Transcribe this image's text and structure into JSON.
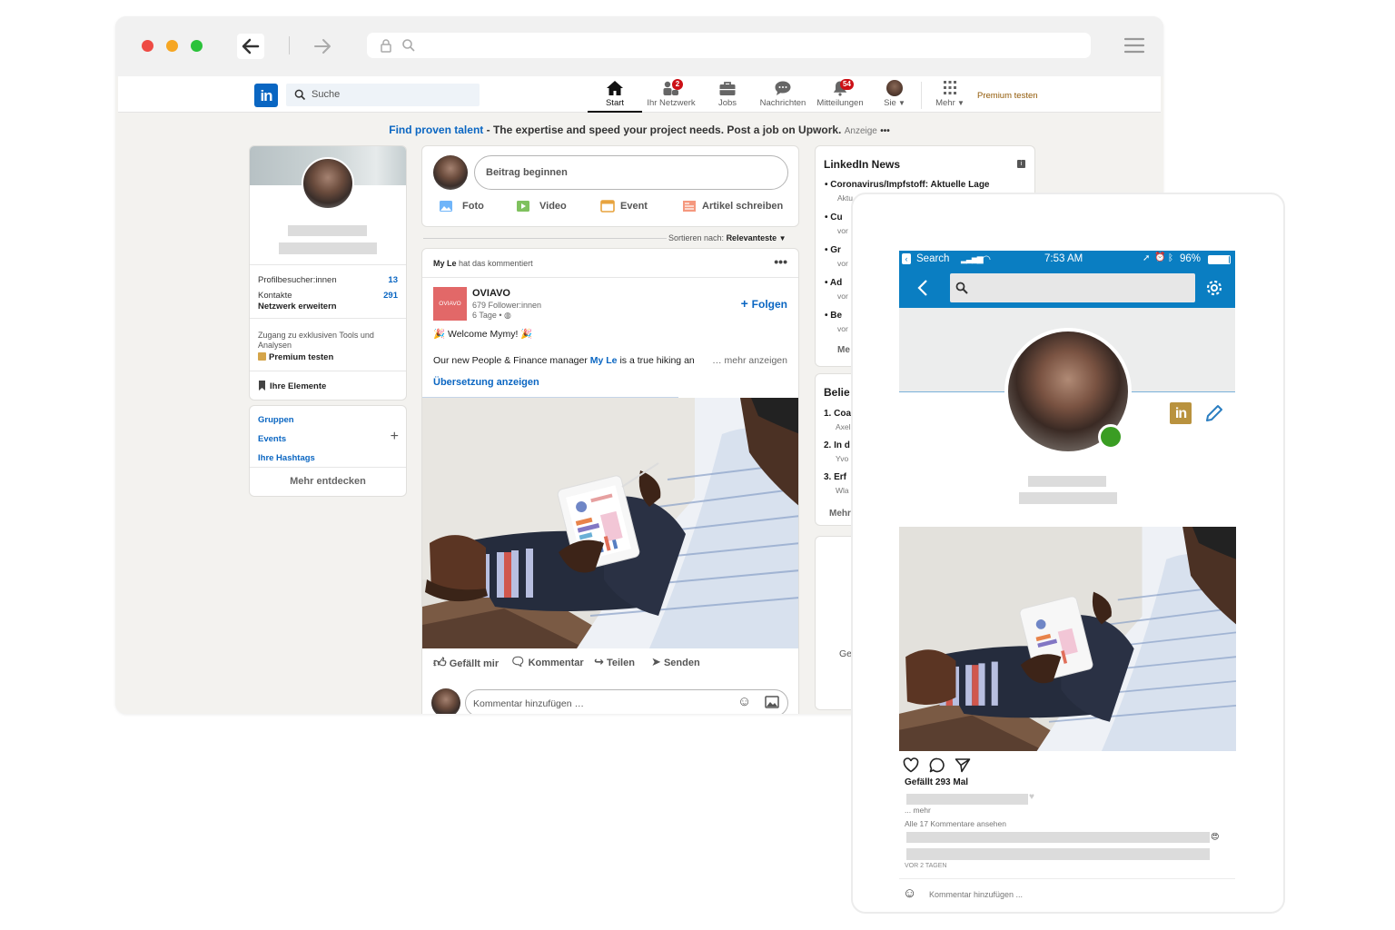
{
  "colors": {
    "brand": "#0a66c2",
    "premium": "#915907",
    "badge": "#cc1016",
    "ios_blue": "#0a7ec2",
    "online": "#3a9d23"
  },
  "nav": {
    "logo": "in",
    "search_placeholder": "Suche",
    "items": [
      {
        "label": "Start",
        "icon": "home-icon"
      },
      {
        "label": "Ihr Netzwerk",
        "icon": "network-icon",
        "badge": "2"
      },
      {
        "label": "Jobs",
        "icon": "briefcase-icon"
      },
      {
        "label": "Nachrichten",
        "icon": "chat-icon"
      },
      {
        "label": "Mitteilungen",
        "icon": "bell-icon",
        "badge": "54"
      },
      {
        "label": "Sie",
        "icon": "avatar-icon"
      },
      {
        "label": "Mehr",
        "icon": "grid-icon"
      }
    ],
    "premium": "Premium testen"
  },
  "ad": {
    "link": "Find proven talent",
    "sep": " - ",
    "text": "The expertise and speed your project needs. Post a job on Upwork.",
    "label": "Anzeige",
    "more": "•••"
  },
  "profile": {
    "visitors_label": "Profilbesucher:innen",
    "visitors": "13",
    "contacts_label": "Kontakte",
    "contacts": "291",
    "expand": "Netzwerk erweitern",
    "premium_text": "Zugang zu exklusiven Tools und Analysen",
    "premium_cta": "Premium testen",
    "items": "Ihre Elemente"
  },
  "left_links": {
    "groups": "Gruppen",
    "events": "Events",
    "hashtags": "Ihre Hashtags",
    "discover": "Mehr entdecken"
  },
  "composer": {
    "placeholder": "Beitrag beginnen",
    "photo": "Foto",
    "video": "Video",
    "event": "Event",
    "article": "Artikel schreiben"
  },
  "sort": {
    "label": "Sortieren nach:",
    "value": "Relevanteste"
  },
  "post": {
    "actor": "My Le",
    "actor_action": "hat das kommentiert",
    "company": "OVIAVO",
    "logo_text": "OVIAVO",
    "followers": "679 Follower:innen",
    "age": "6 Tage •",
    "follow": "Folgen",
    "welcome": "🎉 Welcome Mymy! 🎉",
    "body_pre": "Our new People & Finance manager ",
    "body_link": "My Le",
    "body_post": " is a true hiking an",
    "more": "… mehr anzeigen",
    "translate": "Übersetzung anzeigen",
    "like": "Gefällt mir",
    "comment": "Kommentar",
    "share": "Teilen",
    "send": "Senden",
    "comment_placeholder": "Kommentar hinzufügen …"
  },
  "news": {
    "title": "LinkedIn News",
    "items": [
      {
        "title": "Coronavirus/Impfstoff: Aktuelle Lage",
        "sub": "Aktu"
      },
      {
        "title": "Cu",
        "sub": "vor"
      },
      {
        "title": "Gr",
        "sub": "vor"
      },
      {
        "title": "Ad",
        "sub": "vor"
      },
      {
        "title": "Be",
        "sub": "vor"
      }
    ],
    "more": "Me"
  },
  "courses": {
    "title": "Belie",
    "items": [
      {
        "title": "1. Coa",
        "sub": "Axel"
      },
      {
        "title": "2. In d",
        "sub": "Yvo"
      },
      {
        "title": "3. Erf",
        "sub": "Wla"
      }
    ],
    "more": "Mehr"
  },
  "third_card": {
    "text": "Ge"
  },
  "phone": {
    "status_left": "Search",
    "time": "7:53 AM",
    "battery": "96%",
    "likes": "Gefällt 293 Mal",
    "more": "... mehr",
    "view_comments": "Alle 17 Kommentare ansehen",
    "age": "VOR 2 TAGEN",
    "comment_placeholder": "Kommentar hinzufügen ..."
  }
}
